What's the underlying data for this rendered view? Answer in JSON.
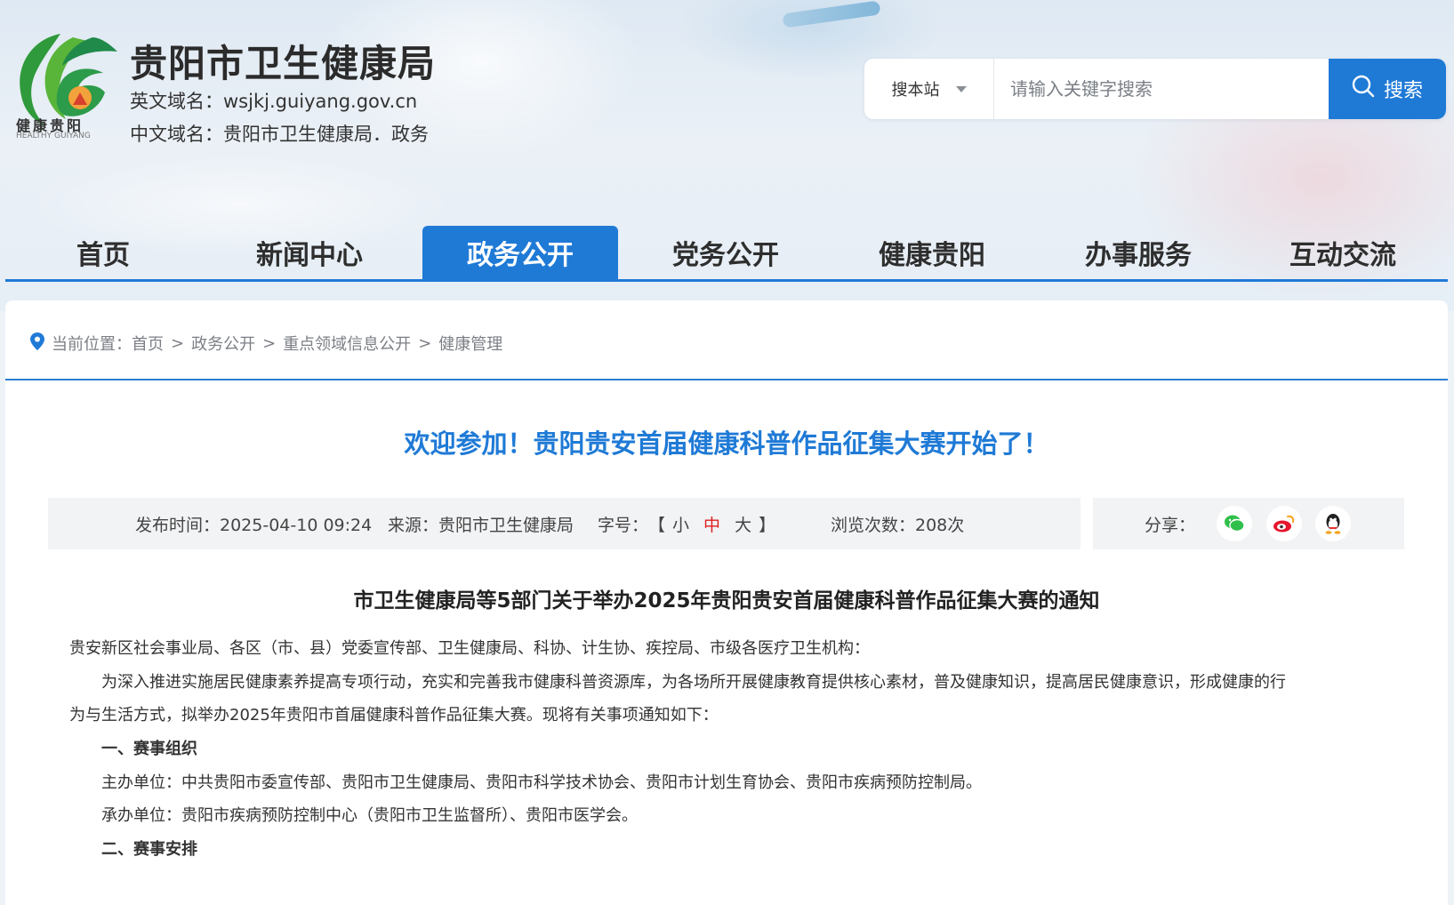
{
  "header": {
    "site_title": "贵阳市卫生健康局",
    "en_domain": "英文域名：wsjkj.guiyang.gov.cn",
    "cn_domain": "中文域名：贵阳市卫生健康局．政务",
    "logo_text": "健康贵阳",
    "logo_subtext": "HEALTHY GUIYANG"
  },
  "search": {
    "scope": "搜本站",
    "placeholder": "请输入关键字搜索",
    "button_label": "搜索"
  },
  "nav": {
    "items": [
      "首页",
      "新闻中心",
      "政务公开",
      "党务公开",
      "健康贵阳",
      "办事服务",
      "互动交流"
    ],
    "active": "政务公开"
  },
  "breadcrumb": {
    "prefix": "当前位置：",
    "items": [
      "首页",
      "政务公开",
      "重点领域信息公开",
      "健康管理"
    ],
    "separator": ">"
  },
  "article": {
    "title": "欢迎参加！贵阳贵安首届健康科普作品征集大赛开始了！",
    "meta": {
      "publish_time": "发布时间：2025-04-10 09:24",
      "source": "来源：贵阳市卫生健康局",
      "font_label": "字号：",
      "font_open": "【",
      "font_small": "小",
      "font_medium": "中",
      "font_large": "大",
      "font_close": "】",
      "views": "浏览次数：208次"
    },
    "share_label": "分享：",
    "share_icons": [
      "wechat-icon",
      "weibo-icon",
      "qq-icon"
    ],
    "doc_title": "市卫生健康局等5部门关于举办2025年贵阳贵安首届健康科普作品征集大赛的通知",
    "paragraphs": {
      "p1": "贵安新区社会事业局、各区（市、县）党委宣传部、卫生健康局、科协、计生协、疾控局、市级各医疗卫生机构：",
      "p2a": "为深入推进实施居民健康素养提高专项行动，充实和完善我市健康科普资源库，为各场所开展健康教育提供核心素材，普及健康知识，提高居民健康意识，形成健康的行",
      "p2b": "为与生活方式，拟举办2025年贵阳市首届健康科普作品征集大赛。现将有关事项通知如下：",
      "h1": "一、赛事组织",
      "p3": "主办单位：中共贵阳市委宣传部、贵阳市卫生健康局、贵阳市科学技术协会、贵阳市计划生育协会、贵阳市疾病预防控制局。",
      "p4": "承办单位：贵阳市疾病预防控制中心（贵阳市卫生监督所）、贵阳市医学会。",
      "h2": "二、赛事安排"
    }
  },
  "colors": {
    "primary": "#1f7ad6",
    "title_blue": "#1f7ad6",
    "meta_bg": "#f2f3f5",
    "font_mid_red": "#dd2222"
  }
}
